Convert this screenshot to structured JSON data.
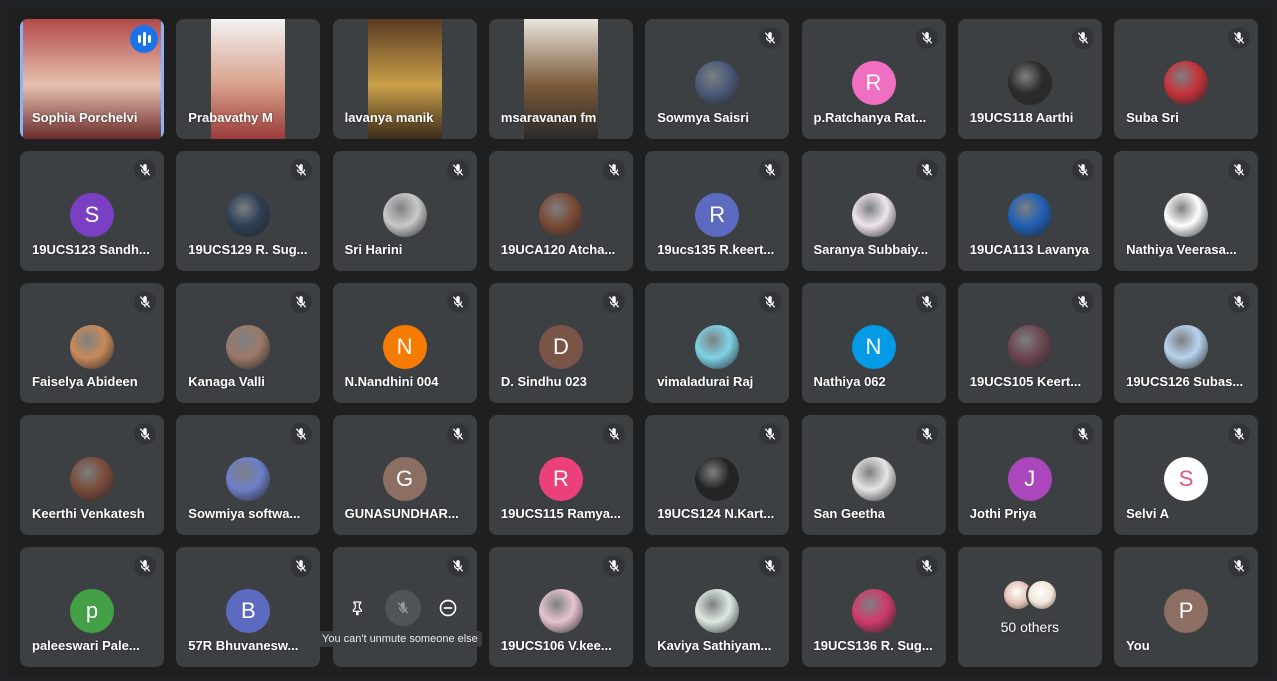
{
  "colors": {
    "background": "#202124",
    "tile": "#3c4043",
    "active_outline": "#8ab4f8",
    "speaking_badge": "#1a73e8"
  },
  "tiles": [
    {
      "name": "Sophia Porchelvi",
      "kind": "video",
      "active": true
    },
    {
      "name": "Prabavathy M",
      "kind": "video"
    },
    {
      "name": "lavanya manik",
      "kind": "video"
    },
    {
      "name": "msaravanan fm",
      "kind": "video"
    },
    {
      "name": "Sowmya Saisri",
      "kind": "photo",
      "color": "#4a5a78"
    },
    {
      "name": "p.Ratchanya Rat...",
      "kind": "letter",
      "letter": "R",
      "color": "#f06fc0"
    },
    {
      "name": "19UCS118 Aarthi",
      "kind": "photo",
      "color": "#2b2b2b"
    },
    {
      "name": "Suba Sri",
      "kind": "photo",
      "color": "#c7323a"
    },
    {
      "name": "19UCS123 Sandh...",
      "kind": "letter",
      "letter": "S",
      "color": "#7b3fc4"
    },
    {
      "name": "19UCS129 R. Sug...",
      "kind": "photo",
      "color": "#2d3f55"
    },
    {
      "name": "Sri Harini",
      "kind": "photo",
      "color": "#c9c9c9"
    },
    {
      "name": "19UCA120 Atcha...",
      "kind": "photo",
      "color": "#7a4a34"
    },
    {
      "name": "19ucs135 R.keert...",
      "kind": "letter",
      "letter": "R",
      "color": "#5c6bc0"
    },
    {
      "name": "Saranya Subbaiy...",
      "kind": "photo",
      "color": "#efe6ec"
    },
    {
      "name": "19UCA113 Lavanya",
      "kind": "photo",
      "color": "#1f5fb5"
    },
    {
      "name": "Nathiya Veerasa...",
      "kind": "photo",
      "color": "#ffffff"
    },
    {
      "name": "Faiselya Abideen",
      "kind": "photo",
      "color": "#c98a5a"
    },
    {
      "name": "Kanaga Valli",
      "kind": "photo",
      "color": "#9c7a6a"
    },
    {
      "name": "N.Nandhini 004",
      "kind": "letter",
      "letter": "N",
      "color": "#f57c00"
    },
    {
      "name": "D. Sindhu 023",
      "kind": "letter",
      "letter": "D",
      "color": "#795548"
    },
    {
      "name": "vimaladurai Raj",
      "kind": "photo",
      "color": "#7fd3e6"
    },
    {
      "name": "Nathiya 062",
      "kind": "letter",
      "letter": "N",
      "color": "#039be5"
    },
    {
      "name": "19UCS105 Keert...",
      "kind": "photo",
      "color": "#6b4550"
    },
    {
      "name": "19UCS126 Subas...",
      "kind": "photo",
      "color": "#b9d3ee"
    },
    {
      "name": "Keerthi Venkatesh",
      "kind": "photo",
      "color": "#7b4b3a"
    },
    {
      "name": "Sowmiya softwa...",
      "kind": "photo",
      "color": "#6e7fc9"
    },
    {
      "name": "GUNASUNDHAR...",
      "kind": "letter",
      "letter": "G",
      "color": "#8d6e63"
    },
    {
      "name": "19UCS115 Ramya...",
      "kind": "letter",
      "letter": "R",
      "color": "#ec407a"
    },
    {
      "name": "19UCS124 N.Kart...",
      "kind": "photo",
      "color": "#232323"
    },
    {
      "name": "San Geetha",
      "kind": "photo",
      "color": "#e5e5e5"
    },
    {
      "name": "Jothi Priya",
      "kind": "letter",
      "letter": "J",
      "color": "#ab47bc"
    },
    {
      "name": "Selvi A",
      "kind": "letter",
      "letter": "S",
      "color": "#ffffff",
      "text_color": "#e05780"
    },
    {
      "name": "paleeswari Pale...",
      "kind": "letter",
      "letter": "p",
      "color": "#43a047"
    },
    {
      "name": "57R Bhuvanesw...",
      "kind": "letter",
      "letter": "B",
      "color": "#5c6bc0"
    },
    {
      "name": "",
      "kind": "hover"
    },
    {
      "name": "19UCS106 V.kee...",
      "kind": "photo",
      "color": "#e8c4cf"
    },
    {
      "name": "Kaviya Sathiyam...",
      "kind": "photo",
      "color": "#dfe9e2"
    },
    {
      "name": "19UCS136 R. Sug...",
      "kind": "photo",
      "color": "#d13a6b"
    },
    {
      "name": "50 others",
      "kind": "others"
    },
    {
      "name": "You",
      "kind": "letter",
      "letter": "P",
      "color": "#8d6e63"
    }
  ],
  "hover": {
    "tooltip": "You can't unmute someone else",
    "icons": [
      "pin-icon",
      "mic-off-icon",
      "remove-icon"
    ]
  }
}
